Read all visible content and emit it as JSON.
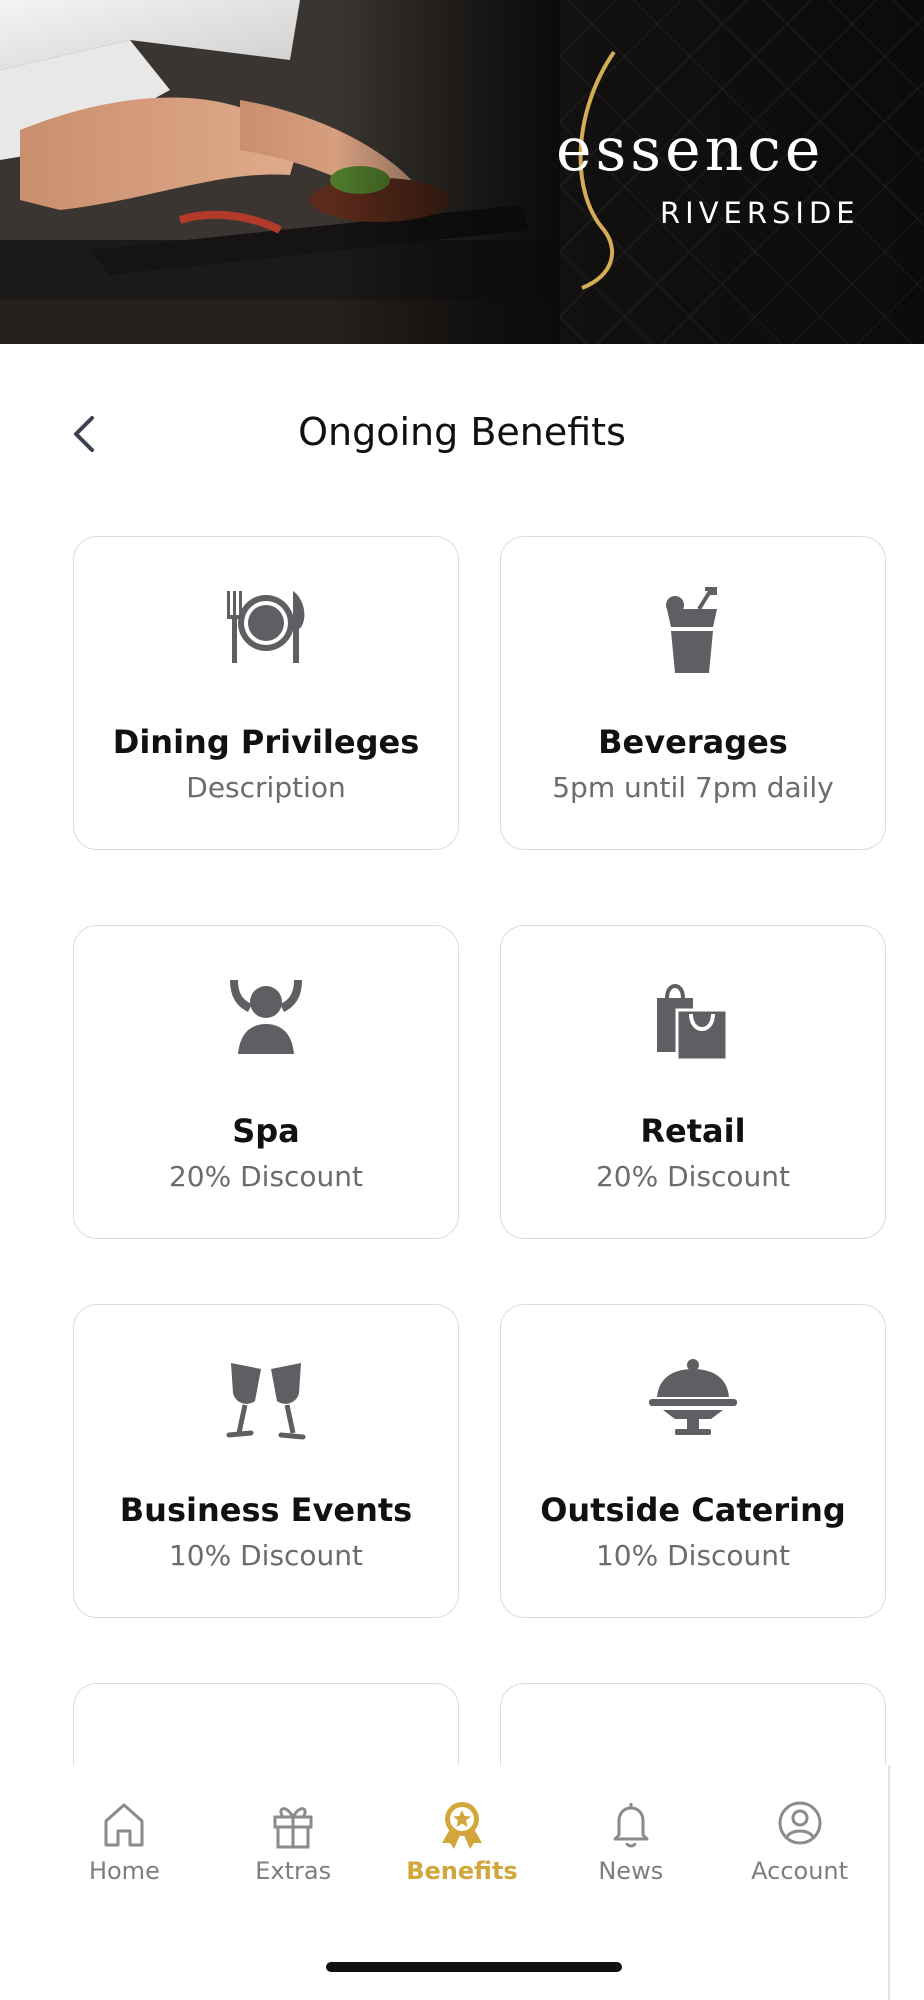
{
  "brand": {
    "name": "essence",
    "subtitle": "RIVERSIDE"
  },
  "header": {
    "title": "Ongoing Benefits"
  },
  "benefits": [
    {
      "title": "Dining Privileges",
      "subtitle": "Description",
      "icon": "dining-plate-icon"
    },
    {
      "title": "Beverages",
      "subtitle": "5pm until 7pm daily",
      "icon": "drink-cup-icon"
    },
    {
      "title": "Spa",
      "subtitle": "20% Discount",
      "icon": "spa-person-icon"
    },
    {
      "title": "Retail",
      "subtitle": "20% Discount",
      "icon": "shopping-bags-icon"
    },
    {
      "title": "Business Events",
      "subtitle": "10% Discount",
      "icon": "wine-glasses-icon"
    },
    {
      "title": "Outside Catering",
      "subtitle": "10% Discount",
      "icon": "catering-cloche-icon"
    }
  ],
  "tabbar": {
    "items": [
      {
        "label": "Home",
        "icon": "home-icon",
        "active": false
      },
      {
        "label": "Extras",
        "icon": "gift-icon",
        "active": false
      },
      {
        "label": "Benefits",
        "icon": "award-badge-icon",
        "active": true
      },
      {
        "label": "News",
        "icon": "bell-icon",
        "active": false
      },
      {
        "label": "Account",
        "icon": "account-icon",
        "active": false
      }
    ]
  },
  "colors": {
    "accent": "#d1a63a",
    "icon": "#5f5f63",
    "text": "#111111",
    "muted": "#6b6b70"
  }
}
